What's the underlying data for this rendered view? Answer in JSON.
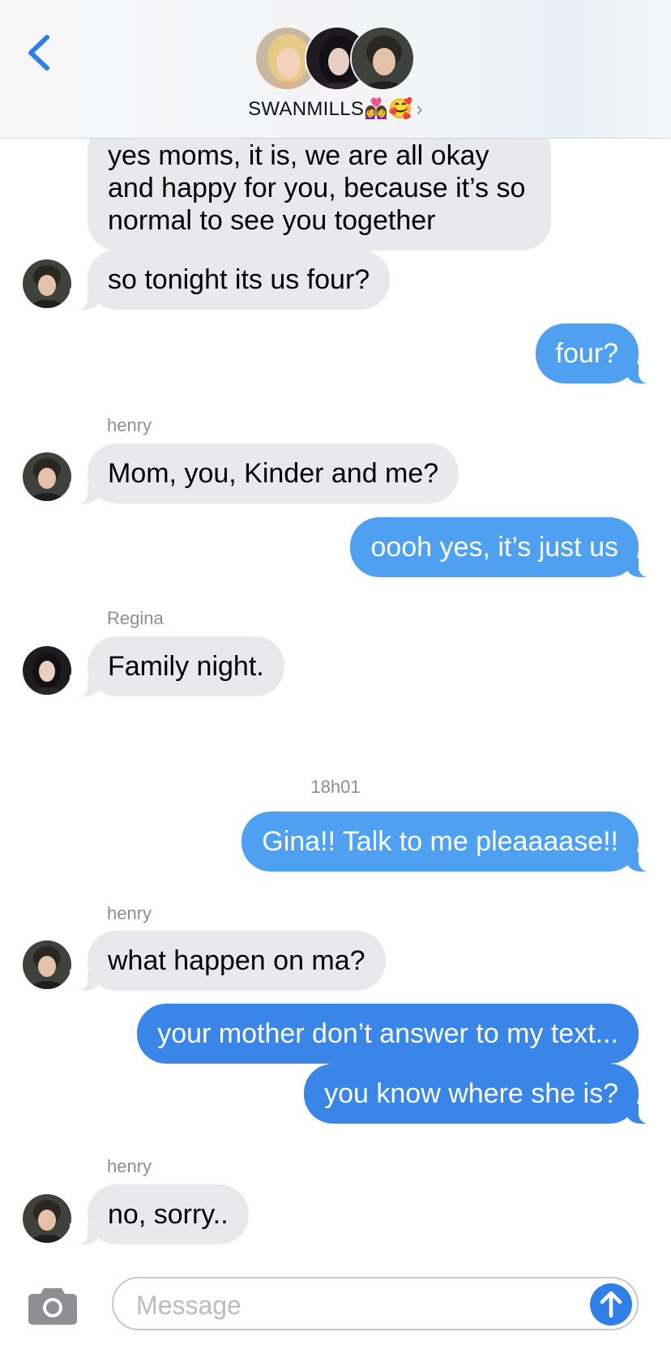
{
  "header": {
    "group_name": "SWANMILLS",
    "emojis": "👩‍❤️‍👩🥰",
    "chevron": "›",
    "avatars": [
      "avatar-blonde",
      "avatar-dark-hair",
      "avatar-boy"
    ]
  },
  "colors": {
    "incoming_bubble": "#e9e9eb",
    "outgoing_light": "#4fa0f0",
    "outgoing_dark": "#3a85e8",
    "accent": "#2f7fe6"
  },
  "messages": {
    "m1": "yes moms, it is, we are all okay and happy for you, because it’s so normal to see you together",
    "m2": "so tonight its us four?",
    "m3": "four?",
    "m4_sender": "henry",
    "m4": "Mom, you, Kinder and me?",
    "m5": "oooh yes, it’s just us",
    "m6_sender": "Regina",
    "m6": "Family night.",
    "timestamp": "18h01",
    "m7": "Gina!! Talk to me pleaaaase!!",
    "m8_sender": "henry",
    "m8": "what happen on ma?",
    "m9": "your mother don’t answer to my text...",
    "m10": "you know where she is?",
    "m11_sender": "henry",
    "m11": "no, sorry.."
  },
  "composer": {
    "placeholder": "Message"
  }
}
